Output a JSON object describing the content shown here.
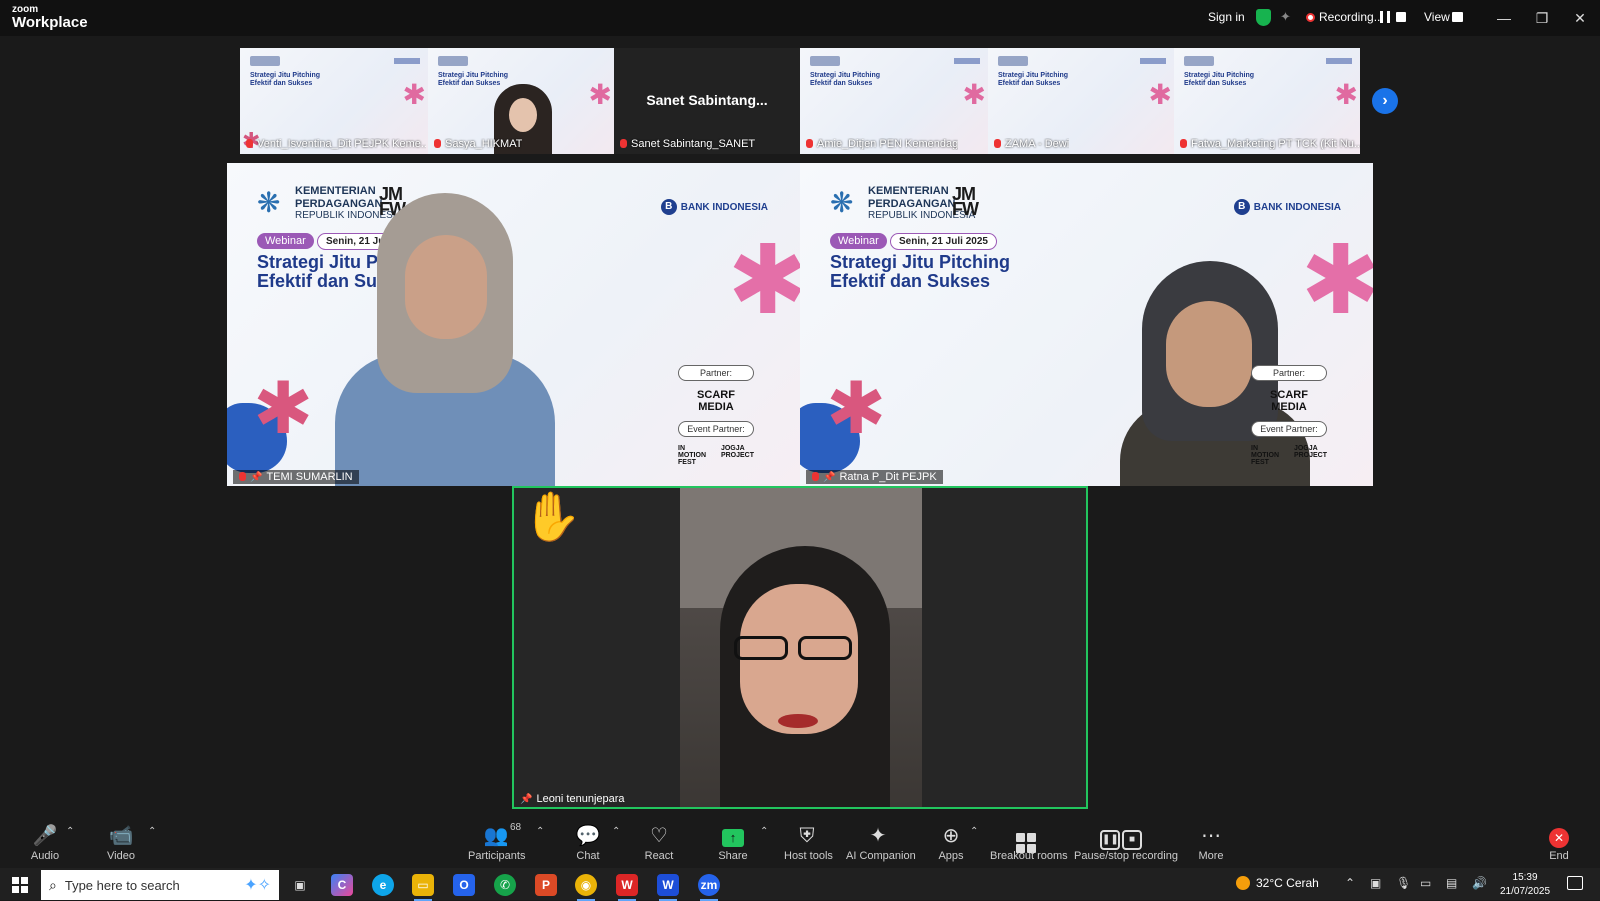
{
  "app": {
    "logo_top": "zoom",
    "logo_bottom": "Workplace"
  },
  "titlebar": {
    "sign_in": "Sign in",
    "recording": "Recording...",
    "view": "View"
  },
  "strip": {
    "thumbs": [
      {
        "name": "Venti_Isventina_Dit PEJPK Keme..."
      },
      {
        "name": "Sasya_HIKMAT"
      },
      {
        "name": "Sanet Sabintang_SANET",
        "big_name": "Sanet  Sabintang..."
      },
      {
        "name": "Amie_Ditjen PEN Kemendag"
      },
      {
        "name": "ZAMA - Dewi"
      },
      {
        "name": "Fatwa_Marketing PT TCK (Kit Nu..."
      }
    ]
  },
  "slide": {
    "ministry_line1": "KEMENTERIAN",
    "ministry_line2": "PERDAGANGAN",
    "ministry_line3": "REPUBLIK INDONESIA",
    "bank": "BANK INDONESIA",
    "webinar": "Webinar",
    "date": "Senin, 21 Juli 2025",
    "title_line1": "Strategi Jitu Pitching",
    "title_line2": "Efektif dan Sukses",
    "partner_label": "Partner:",
    "partner_name": "SCARF MEDIA",
    "event_partner_label": "Event Partner:"
  },
  "main_tiles": [
    {
      "name": "TEMI SUMARLIN"
    },
    {
      "name": "Ratna P_Dit PEJPK"
    }
  ],
  "speaker": {
    "name": "Leoni tenunjepara",
    "reaction": "✋"
  },
  "toolbar": {
    "audio": "Audio",
    "video": "Video",
    "participants": "Participants",
    "participants_count": "68",
    "chat": "Chat",
    "react": "React",
    "share": "Share",
    "host_tools": "Host tools",
    "ai_companion": "AI Companion",
    "apps": "Apps",
    "breakout_rooms": "Breakout rooms",
    "pause_stop_recording": "Pause/stop recording",
    "more": "More",
    "end": "End"
  },
  "taskbar": {
    "search_placeholder": "Type here to search",
    "weather": "32°C  Cerah",
    "time": "15:39",
    "date": "21/07/2025"
  },
  "colors": {
    "accent_green": "#22c55e",
    "record_red": "#e33333",
    "zoom_blue": "#1a73e8"
  }
}
